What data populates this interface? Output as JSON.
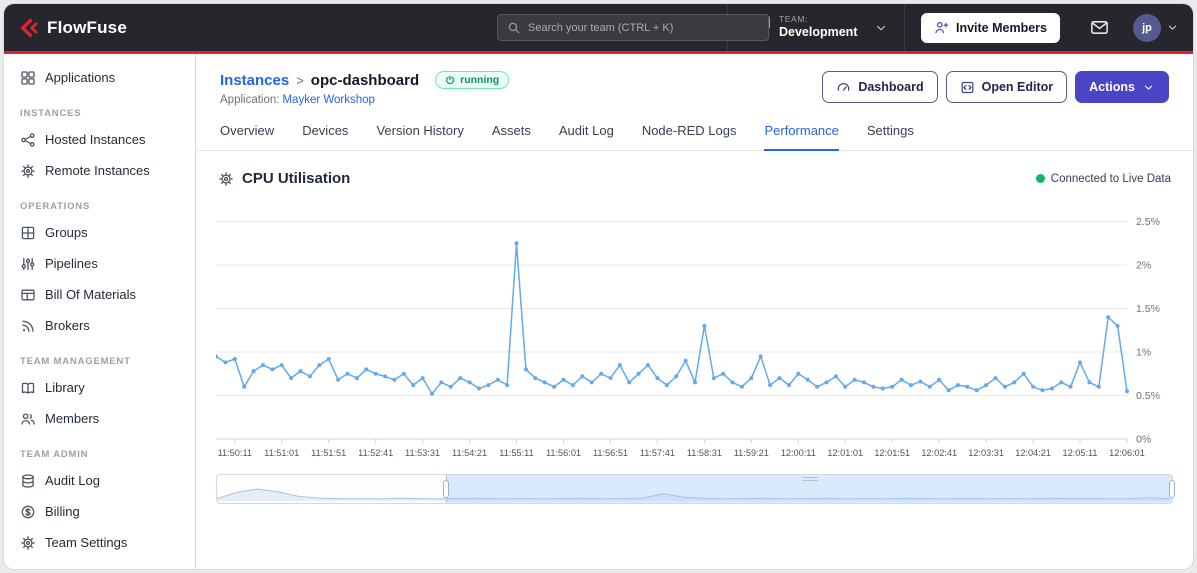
{
  "colors": {
    "accent_red": "#E0232E",
    "primary_indigo": "#4945C6",
    "link_blue": "#2563EB",
    "chart_line": "#64A9EC",
    "status_green": "#12B76A"
  },
  "topbar": {
    "brand": "FlowFuse",
    "search_placeholder": "Search your team (CTRL + K)",
    "team_label": "TEAM:",
    "team_name": "Development",
    "invite_button": "Invite Members",
    "avatar_text": "jp"
  },
  "sidebar": {
    "sections": [
      {
        "title": "",
        "items": [
          {
            "label": "Applications",
            "icon": "applications-icon"
          }
        ]
      },
      {
        "title": "INSTANCES",
        "items": [
          {
            "label": "Hosted Instances",
            "icon": "hosted-instances-icon"
          },
          {
            "label": "Remote Instances",
            "icon": "remote-instances-icon"
          }
        ]
      },
      {
        "title": "OPERATIONS",
        "items": [
          {
            "label": "Groups",
            "icon": "groups-icon"
          },
          {
            "label": "Pipelines",
            "icon": "pipelines-icon"
          },
          {
            "label": "Bill Of Materials",
            "icon": "bill-of-materials-icon"
          },
          {
            "label": "Brokers",
            "icon": "brokers-icon"
          }
        ]
      },
      {
        "title": "TEAM MANAGEMENT",
        "items": [
          {
            "label": "Library",
            "icon": "library-icon"
          },
          {
            "label": "Members",
            "icon": "members-icon"
          }
        ]
      },
      {
        "title": "TEAM ADMIN",
        "items": [
          {
            "label": "Audit Log",
            "icon": "audit-log-icon"
          },
          {
            "label": "Billing",
            "icon": "billing-icon"
          },
          {
            "label": "Team Settings",
            "icon": "team-settings-icon"
          }
        ]
      }
    ]
  },
  "header": {
    "breadcrumb_parent": "Instances",
    "breadcrumb_sep": ">",
    "instance_name": "opc-dashboard",
    "status_badge": "running",
    "application_label": "Application:",
    "application_name": "Mayker Workshop",
    "buttons": {
      "dashboard": "Dashboard",
      "open_editor": "Open Editor",
      "actions": "Actions"
    }
  },
  "tabs": [
    "Overview",
    "Devices",
    "Version History",
    "Assets",
    "Audit Log",
    "Node-RED Logs",
    "Performance",
    "Settings"
  ],
  "active_tab": "Performance",
  "chart": {
    "title": "CPU Utilisation",
    "status": "Connected to Live Data"
  },
  "chart_data": {
    "type": "line",
    "title": "CPU Utilisation",
    "unit": "%",
    "ylim": [
      0,
      2.65
    ],
    "grid": true,
    "legend": "none",
    "y_axis_side": "right",
    "y_ticks": [
      {
        "v": 0,
        "label": "0%"
      },
      {
        "v": 0.5,
        "label": "0.5%"
      },
      {
        "v": 1,
        "label": "1%"
      },
      {
        "v": 1.5,
        "label": "1.5%"
      },
      {
        "v": 2,
        "label": "2%"
      },
      {
        "v": 2.5,
        "label": "2.5%"
      }
    ],
    "x_ticks": [
      "11:50:11",
      "11:51:01",
      "11:51:51",
      "11:52:41",
      "11:53:31",
      "11:54:21",
      "11:55:11",
      "11:56:01",
      "11:56:51",
      "11:57:41",
      "11:58:31",
      "11:59:21",
      "12:00:11",
      "12:01:01",
      "12:01:51",
      "12:02:41",
      "12:03:31",
      "12:04:21",
      "12:05:11",
      "12:06:01"
    ],
    "x_tick_first_index": 2,
    "x_tick_step": 5,
    "sample_interval_seconds": 10,
    "values": [
      0.95,
      0.88,
      0.92,
      0.6,
      0.78,
      0.85,
      0.8,
      0.85,
      0.7,
      0.78,
      0.72,
      0.85,
      0.92,
      0.68,
      0.75,
      0.7,
      0.8,
      0.75,
      0.72,
      0.68,
      0.75,
      0.62,
      0.7,
      0.52,
      0.65,
      0.6,
      0.7,
      0.65,
      0.58,
      0.62,
      0.68,
      0.62,
      2.25,
      0.8,
      0.7,
      0.65,
      0.6,
      0.68,
      0.62,
      0.72,
      0.65,
      0.75,
      0.7,
      0.85,
      0.65,
      0.75,
      0.85,
      0.7,
      0.62,
      0.72,
      0.9,
      0.65,
      1.3,
      0.7,
      0.75,
      0.65,
      0.6,
      0.7,
      0.95,
      0.62,
      0.7,
      0.62,
      0.75,
      0.68,
      0.6,
      0.65,
      0.72,
      0.6,
      0.68,
      0.65,
      0.6,
      0.58,
      0.6,
      0.68,
      0.62,
      0.66,
      0.6,
      0.68,
      0.56,
      0.62,
      0.6,
      0.56,
      0.62,
      0.7,
      0.6,
      0.65,
      0.75,
      0.6,
      0.56,
      0.58,
      0.65,
      0.6,
      0.88,
      0.65,
      0.6,
      1.4,
      1.3,
      0.55
    ],
    "line_color": "#64A9EC",
    "navigator": {
      "selection_start_pct": 24,
      "selection_end_pct": 100,
      "values": [
        0.06,
        0.32,
        0.46,
        0.34,
        0.16,
        0.08,
        0.06,
        0.06,
        0.05,
        0.07,
        0.06,
        0.05,
        0.06,
        0.07,
        0.05,
        0.06,
        0.05,
        0.06,
        0.07,
        0.05,
        0.06,
        0.08,
        0.26,
        0.12,
        0.07,
        0.05,
        0.06,
        0.07,
        0.05,
        0.06,
        0.07,
        0.05,
        0.06,
        0.05,
        0.07,
        0.06,
        0.05,
        0.07,
        0.05,
        0.06,
        0.05,
        0.07,
        0.06,
        0.07,
        0.05,
        0.06,
        0.09,
        0.06
      ]
    }
  }
}
